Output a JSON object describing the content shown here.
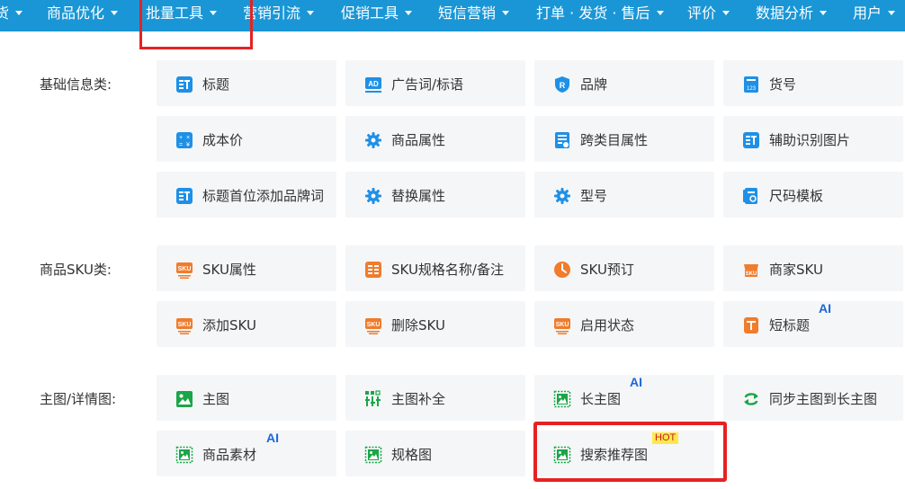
{
  "nav": {
    "items": [
      {
        "label": "货"
      },
      {
        "label": "商品优化"
      },
      {
        "label": "批量工具"
      },
      {
        "label": "营销引流"
      },
      {
        "label": "促销工具"
      },
      {
        "label": "短信营销"
      },
      {
        "label": "打单 · 发货 · 售后"
      },
      {
        "label": "评价"
      },
      {
        "label": "数据分析"
      },
      {
        "label": "用户"
      }
    ],
    "highlighted_item": "批量工具"
  },
  "sections": [
    {
      "label": "基础信息类:",
      "tiles": [
        {
          "label": "标题",
          "icon": "title-icon"
        },
        {
          "label": "广告词/标语",
          "icon": "ad-icon"
        },
        {
          "label": "品牌",
          "icon": "brand-icon"
        },
        {
          "label": "货号",
          "icon": "item-number-icon"
        },
        {
          "label": "成本价",
          "icon": "calculator-icon"
        },
        {
          "label": "商品属性",
          "icon": "gear-icon"
        },
        {
          "label": "跨类目属性",
          "icon": "cross-category-icon"
        },
        {
          "label": "辅助识别图片",
          "icon": "title-icon"
        },
        {
          "label": "标题首位添加品牌词",
          "icon": "title-icon"
        },
        {
          "label": "替换属性",
          "icon": "gear-icon"
        },
        {
          "label": "型号",
          "icon": "gear-icon"
        },
        {
          "label": "尺码模板",
          "icon": "size-template-icon"
        }
      ]
    },
    {
      "label": "商品SKU类:",
      "tiles": [
        {
          "label": "SKU属性",
          "icon": "sku-icon"
        },
        {
          "label": "SKU规格名称/备注",
          "icon": "sku-spec-icon"
        },
        {
          "label": "SKU预订",
          "icon": "clock-icon"
        },
        {
          "label": "商家SKU",
          "icon": "merchant-sku-icon"
        },
        {
          "label": "添加SKU",
          "icon": "sku-icon"
        },
        {
          "label": "删除SKU",
          "icon": "sku-icon"
        },
        {
          "label": "启用状态",
          "icon": "sku-icon"
        },
        {
          "label": "短标题",
          "icon": "short-title-icon",
          "badge": "AI"
        }
      ]
    },
    {
      "label": "主图/详情图:",
      "tiles": [
        {
          "label": "主图",
          "icon": "image-icon"
        },
        {
          "label": "主图补全",
          "icon": "image-complete-icon"
        },
        {
          "label": "长主图",
          "icon": "long-image-icon",
          "badge": "AI"
        },
        {
          "label": "同步主图到长主图",
          "icon": "sync-icon"
        },
        {
          "label": "商品素材",
          "icon": "long-image-icon",
          "badge": "AI"
        },
        {
          "label": "规格图",
          "icon": "long-image-icon"
        },
        {
          "label": "搜索推荐图",
          "icon": "long-image-icon",
          "badge": "HOT"
        }
      ]
    }
  ],
  "colors": {
    "nav_bg": "#1a96d6",
    "tile_bg": "#f5f6f8",
    "icon_blue": "#1e90e6",
    "icon_orange": "#f07c2c",
    "icon_green": "#1aa648",
    "highlight_red": "#e52222",
    "ai_badge": "#1c67d8",
    "hot_badge_bg": "#ffe84d"
  }
}
